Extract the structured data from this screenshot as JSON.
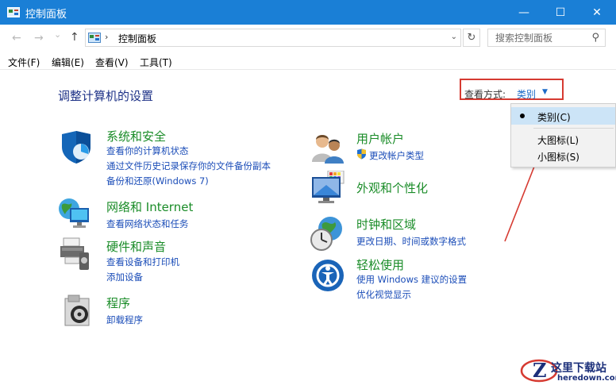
{
  "window": {
    "title": "控制面板",
    "minimize_glyph": "—",
    "maximize_glyph": "☐",
    "close_glyph": "✕",
    "accent": "#1a7fd6"
  },
  "navigation": {
    "back_glyph": "←",
    "forward_glyph": "→",
    "recent_glyph": "⌄",
    "up_glyph": "↑",
    "breadcrumb_sep": "›",
    "path": "控制面板",
    "dropdown_glyph": "⌄",
    "refresh_glyph": "↻",
    "search_placeholder": "搜索控制面板",
    "search_glyph": "⚲"
  },
  "menu": {
    "file": "文件(F)",
    "edit": "编辑(E)",
    "view": "查看(V)",
    "tools": "工具(T)"
  },
  "main": {
    "heading": "调整计算机的设置",
    "view_by_label": "查看方式:",
    "view_by_value": "类别",
    "view_by_caret": "▼"
  },
  "categories": {
    "system_security": {
      "title": "系统和安全",
      "links": [
        "查看你的计算机状态",
        "通过文件历史记录保存你的文件备份副本",
        "备份和还原(Windows 7)"
      ]
    },
    "network": {
      "title": "网络和 Internet",
      "links": [
        "查看网络状态和任务"
      ]
    },
    "hardware": {
      "title": "硬件和声音",
      "links": [
        "查看设备和打印机",
        "添加设备"
      ]
    },
    "programs": {
      "title": "程序",
      "links": [
        "卸载程序"
      ]
    },
    "user_accounts": {
      "title": "用户帐户",
      "links": [
        "更改帐户类型"
      ]
    },
    "appearance": {
      "title": "外观和个性化",
      "links": []
    },
    "clock_region": {
      "title": "时钟和区域",
      "links": [
        "更改日期、时间或数字格式"
      ]
    },
    "ease_access": {
      "title": "轻松使用",
      "links": [
        "使用 Windows 建议的设置",
        "优化视觉显示"
      ]
    }
  },
  "view_menu": {
    "options": [
      "类别(C)",
      "大图标(L)",
      "小图标(S)"
    ],
    "selected": "类别(C)"
  },
  "watermark": {
    "name": "这里下载站",
    "url": "heredown.com"
  }
}
